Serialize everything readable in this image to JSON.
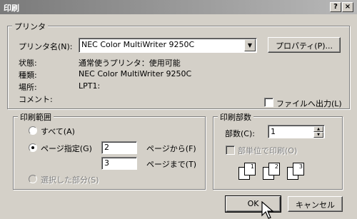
{
  "window": {
    "title": "印刷",
    "help_btn": "?",
    "close_btn": "×"
  },
  "printer": {
    "legend": "プリンタ",
    "name_label": "プリンタ名(N):",
    "name_value": "NEC Color MultiWriter 9250C",
    "properties_btn": "プロパティ(P)...",
    "status_label": "状態:",
    "status_value": "通常使うプリンタ：使用可能",
    "type_label": "種類:",
    "type_value": "NEC Color MultiWriter 9250C",
    "location_label": "場所:",
    "location_value": "LPT1:",
    "comment_label": "コメント:",
    "print_to_file": "ファイルへ出力(L)"
  },
  "range": {
    "legend": "印刷範囲",
    "all": "すべて(A)",
    "pages": "ページ指定(G)",
    "from_value": "2",
    "from_label": "ページから(F)",
    "to_value": "3",
    "to_label": "ページまで(T)",
    "selection": "選択した部分(S)"
  },
  "copies": {
    "legend": "印刷部数",
    "count_label": "部数(C):",
    "count_value": "1",
    "collate": "部単位で印刷(O)",
    "icon_pages": [
      "1",
      "1",
      "2",
      "2",
      "3",
      "3"
    ]
  },
  "buttons": {
    "ok": "OK",
    "cancel": "キャンセル"
  },
  "colors": {
    "face": "#d4d0c8",
    "title_start": "#7a7a7a",
    "title_end": "#b8b8b8"
  }
}
